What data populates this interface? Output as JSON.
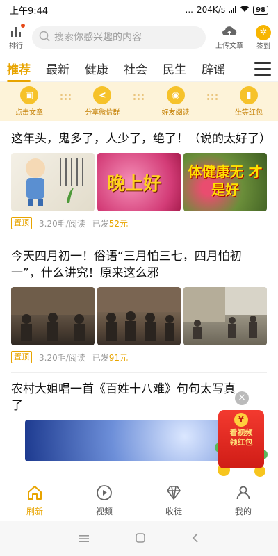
{
  "status_bar": {
    "time": "上午9:44",
    "dots": "...",
    "speed": "204K/s",
    "battery": "98"
  },
  "top_bar": {
    "rank_label": "排行",
    "search_placeholder": "搜索你感兴趣的内容",
    "upload_label": "上传文章",
    "sign_label": "签到",
    "sign_glyph": "✲"
  },
  "tabs": [
    {
      "label": "推荐",
      "active": true
    },
    {
      "label": "最新"
    },
    {
      "label": "健康"
    },
    {
      "label": "社会"
    },
    {
      "label": "民生"
    },
    {
      "label": "辟谣"
    }
  ],
  "tasks": [
    {
      "label": "点击文章",
      "glyph": "▣"
    },
    {
      "label": "分享微信群",
      "glyph": "<"
    },
    {
      "label": "好友阅读",
      "glyph": "◉"
    },
    {
      "label": "坐等红包",
      "glyph": "▮"
    }
  ],
  "articles": [
    {
      "title": "这年头，鬼多了，人少了，绝了！（说的太好了）",
      "badge": "置顶",
      "rate": "3.20毛/阅读",
      "paid_prefix": "已发",
      "paid_amount": "52元",
      "image_texts": [
        "",
        "晚上好",
        "体健康无 才是好"
      ]
    },
    {
      "title": "今天四月初一！俗语“三月怕三七，四月怕初一”，什么讲究！原来这么邪",
      "badge": "置顶",
      "rate": "3.20毛/阅读",
      "paid_prefix": "已发",
      "paid_amount": "91元"
    },
    {
      "title": "农村大姐唱一首《百姓十八难》句句太写真了"
    }
  ],
  "floating_packet": {
    "line1": "看视频",
    "line2": "领红包",
    "coin": "¥",
    "close": "×"
  },
  "bottom_nav": [
    {
      "label": "刷新",
      "icon": "home-icon",
      "active": true
    },
    {
      "label": "视频",
      "icon": "play-icon"
    },
    {
      "label": "收徒",
      "icon": "diamond-icon"
    },
    {
      "label": "我的",
      "icon": "user-icon"
    }
  ],
  "colors": {
    "accent": "#e8a400",
    "task_bg": "#fdf3d9",
    "red_packet": "#f33a2f"
  }
}
